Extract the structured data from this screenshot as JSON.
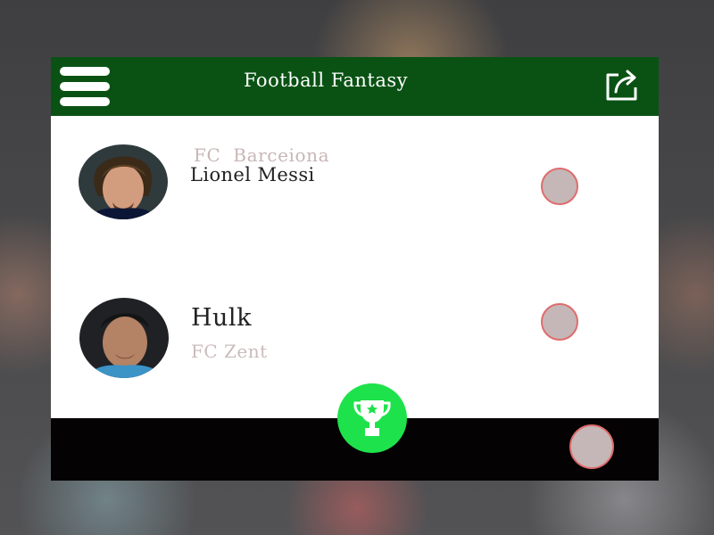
{
  "app": {
    "title": "Football Fantasy",
    "colors": {
      "header": "#0a5214",
      "footer": "#050203",
      "accent": "#1ee24b",
      "radio_fill": "#c5b7b8",
      "radio_border": "#df6c6c"
    }
  },
  "header": {
    "menu_icon": "hamburger-menu-icon",
    "share_icon": "share-icon"
  },
  "players": [
    {
      "club": "FC  Barceiona",
      "name": "Lionel Messi",
      "avatar_icon": "player-photo"
    },
    {
      "name": "Hulk",
      "club": "FC Zent",
      "avatar_icon": "player-photo"
    }
  ],
  "footer": {
    "trophy_icon": "trophy-icon",
    "radio_icon": "radio-icon"
  }
}
